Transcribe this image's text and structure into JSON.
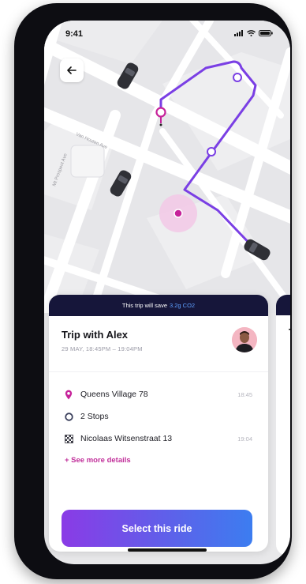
{
  "status_bar": {
    "time": "9:41"
  },
  "map": {
    "streets": [
      "Van Houten Ave",
      "Mt Prospect Ave"
    ],
    "colors": {
      "route": "#7a3fe4",
      "pin": "#c6229a",
      "pulse": "#f2c8e6"
    }
  },
  "ride_card": {
    "banner": {
      "prefix": "This trip will save",
      "amount": "3.2g CO2"
    },
    "title": "Trip with Alex",
    "time_range": "29 MAY, 18:45PM – 19:04PM",
    "stops": [
      {
        "icon": "pin-icon",
        "label": "Queens Village 78",
        "time": "18:45"
      },
      {
        "icon": "stop-circle-icon",
        "label": "2 Stops",
        "time": ""
      },
      {
        "icon": "checkered-flag-icon",
        "label": "Nicolaas Witsenstraat 13",
        "time": "19:04"
      }
    ],
    "details_link": "+ See more details",
    "button_label": "Select this ride",
    "colors": {
      "banner_bg": "#16163a",
      "co2_text": "#5ea0ff",
      "link": "#c12f9a",
      "button_start": "#8a3be6",
      "button_end": "#3c7df0"
    }
  },
  "next_card": {
    "title_initial": "T"
  }
}
